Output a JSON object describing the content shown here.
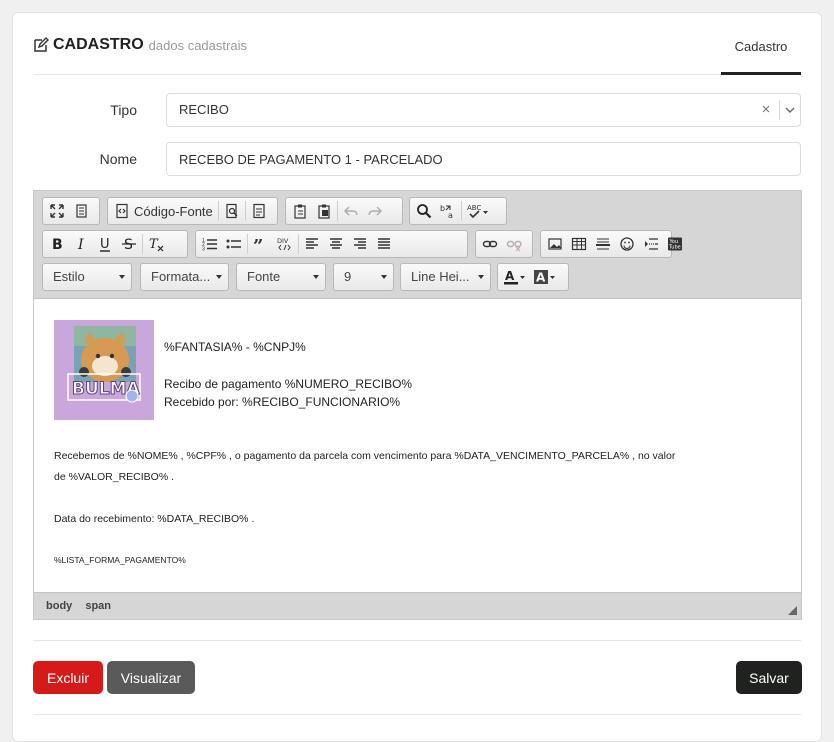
{
  "header": {
    "title": "CADASTRO",
    "subtitle": "dados cadastrais",
    "tab": "Cadastro"
  },
  "form": {
    "tipo_label": "Tipo",
    "tipo_value": "RECIBO",
    "nome_label": "Nome",
    "nome_value": "RECEBO DE PAGAMENTO 1 - PARCELADO"
  },
  "toolbar": {
    "source_label": "Código-Fonte",
    "style_select": "Estilo",
    "format_select": "Formata...",
    "font_select": "Fonte",
    "size_select": "9",
    "lineheight_select": "Line Hei...",
    "icons": [
      "maximize-icon",
      "show-blocks-icon",
      "source-icon",
      "preview-icon",
      "templates-icon",
      "paste-icon",
      "paste-word-icon",
      "undo-icon",
      "redo-icon",
      "find-icon",
      "replace-icon",
      "spellcheck-icon",
      "bold-icon",
      "italic-icon",
      "underline-icon",
      "strike-icon",
      "remove-format-icon",
      "numbered-list-icon",
      "bulleted-list-icon",
      "blockquote-icon",
      "div-icon",
      "align-left-icon",
      "align-center-icon",
      "align-right-icon",
      "justify-icon",
      "link-icon",
      "unlink-icon",
      "image-icon",
      "table-icon",
      "horizontal-rule-icon",
      "smiley-icon",
      "page-break-icon",
      "youtube-icon",
      "text-color-icon",
      "bg-color-icon"
    ]
  },
  "content": {
    "logo_text": "BULMA",
    "line1": "%FANTASIA% - %CNPJ%",
    "line2": "Recibo de pagamento %NUMERO_RECIBO%",
    "line3": "Recebido por: %RECIBO_FUNCIONARIO%",
    "para1a": "Recebemos de %NOME% , %CPF% , o pagamento da parcela com vencimento para %DATA_VENCIMENTO_PARCELA% , no valor",
    "para1b": "de %VALOR_RECIBO% .",
    "para2": "Data do recebimento: %DATA_RECIBO% .",
    "para3": "%LISTA_FORMA_PAGAMENTO%"
  },
  "statusbar": {
    "path1": "body",
    "path2": "span"
  },
  "actions": {
    "delete": "Excluir",
    "preview": "Visualizar",
    "save": "Salvar"
  },
  "colors": {
    "danger": "#d61a1a",
    "secondary": "#5a5a5a",
    "dark": "#1f221f"
  }
}
